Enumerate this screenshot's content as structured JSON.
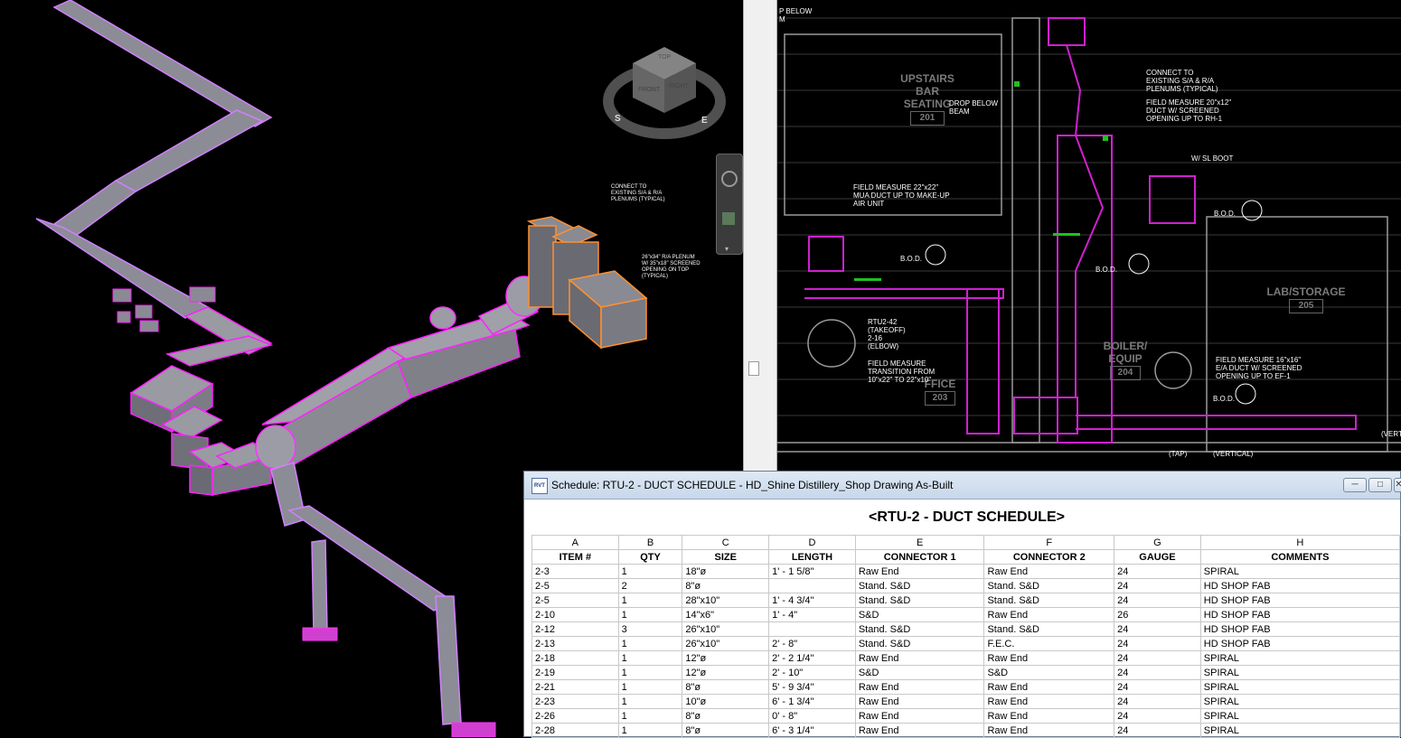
{
  "viewcube": {
    "top": "TOP",
    "front": "FRONT",
    "right": "RIGHT",
    "s": "S",
    "e": "E"
  },
  "labels3d": {
    "connect_note": [
      "CONNECT TO",
      "EXISTING S/A & R/A",
      "PLENUMS (TYPICAL)"
    ],
    "plenum_note": [
      "26\"x34\" R/A PLENUM",
      "W/ 35\"x18\" SCREENED",
      "OPENING ON TOP",
      "(TYPICAL)"
    ]
  },
  "plan": {
    "top_note": [
      "P BELOW",
      "M"
    ],
    "upstairs": "UPSTAIRS",
    "bar": "BAR",
    "seating": "SEATING",
    "room201": "201",
    "lab": "LAB/STORAGE",
    "room205": "205",
    "boiler": "BOILER/",
    "equip": "EQUIP",
    "room204": "204",
    "ffice": "FFICE",
    "room203": "203",
    "drop_below": [
      "DROP BELOW",
      "BEAM"
    ],
    "connect_existing": [
      "CONNECT TO",
      "EXISTING S/A & R/A",
      "PLENUMS (TYPICAL)"
    ],
    "field_20x12": [
      "FIELD MEASURE 20\"x12\"",
      "DUCT W/ SCREENED",
      "OPENING UP TO RH-1"
    ],
    "field_22x22": [
      "FIELD MEASURE 22\"x22\"",
      "MUA DUCT UP TO MAKE-UP",
      "AIR UNIT"
    ],
    "sl_boot": "W/ SL BOOT",
    "bod": "B.O.D.",
    "rtu_takeoff": [
      "RTU2-42",
      "(TAKEOFF)"
    ],
    "elbow": [
      "2-16",
      "(ELBOW)"
    ],
    "transition": [
      "FIELD MEASURE",
      "TRANSITION FROM",
      "10\"x22\" TO 22\"x10\""
    ],
    "field_16x16": [
      "FIELD MEASURE 16\"x16\"",
      "E/A DUCT W/ SCREENED",
      "OPENING UP TO EF-1"
    ],
    "tap": "(TAP)",
    "vertical": "(VERTICAL)",
    "vert": "(VERT"
  },
  "schedule": {
    "window_title": "Schedule: RTU-2 - DUCT SCHEDULE - HD_Shine Distillery_Shop Drawing As-Built",
    "app_icon": "RVT",
    "heading": "<RTU-2 - DUCT SCHEDULE>",
    "letters": [
      "A",
      "B",
      "C",
      "D",
      "E",
      "F",
      "G",
      "H"
    ],
    "columns": [
      "ITEM #",
      "QTY",
      "SIZE",
      "LENGTH",
      "CONNECTOR 1",
      "CONNECTOR 2",
      "GAUGE",
      "COMMENTS"
    ],
    "rows": [
      [
        "2-3",
        "1",
        "18\"ø",
        "1' - 1 5/8\"",
        "Raw End",
        "Raw End",
        "24",
        "SPIRAL"
      ],
      [
        "2-5",
        "2",
        "8\"ø",
        "",
        "Stand. S&D",
        "Stand. S&D",
        "24",
        "HD SHOP FAB"
      ],
      [
        "2-5",
        "1",
        "28\"x10\"",
        "1' - 4 3/4\"",
        "Stand. S&D",
        "Stand. S&D",
        "24",
        "HD SHOP FAB"
      ],
      [
        "2-10",
        "1",
        "14\"x6\"",
        "1' - 4\"",
        "S&D",
        "Raw End",
        "26",
        "HD SHOP FAB"
      ],
      [
        "2-12",
        "3",
        "26\"x10\"",
        "",
        "Stand. S&D",
        "Stand. S&D",
        "24",
        "HD SHOP FAB"
      ],
      [
        "2-13",
        "1",
        "26\"x10\"",
        "2' - 8\"",
        "Stand. S&D",
        "F.E.C.",
        "24",
        "HD SHOP FAB"
      ],
      [
        "2-18",
        "1",
        "12\"ø",
        "2' - 2 1/4\"",
        "Raw End",
        "Raw End",
        "24",
        "SPIRAL"
      ],
      [
        "2-19",
        "1",
        "12\"ø",
        "2' - 10\"",
        "S&D",
        "S&D",
        "24",
        "SPIRAL"
      ],
      [
        "2-21",
        "1",
        "8\"ø",
        "5' - 9 3/4\"",
        "Raw End",
        "Raw End",
        "24",
        "SPIRAL"
      ],
      [
        "2-23",
        "1",
        "10\"ø",
        "6' - 1 3/4\"",
        "Raw End",
        "Raw End",
        "24",
        "SPIRAL"
      ],
      [
        "2-26",
        "1",
        "8\"ø",
        "0' - 8\"",
        "Raw End",
        "Raw End",
        "24",
        "SPIRAL"
      ],
      [
        "2-28",
        "1",
        "8\"ø",
        "6' - 3 1/4\"",
        "Raw End",
        "Raw End",
        "24",
        "SPIRAL"
      ]
    ]
  }
}
